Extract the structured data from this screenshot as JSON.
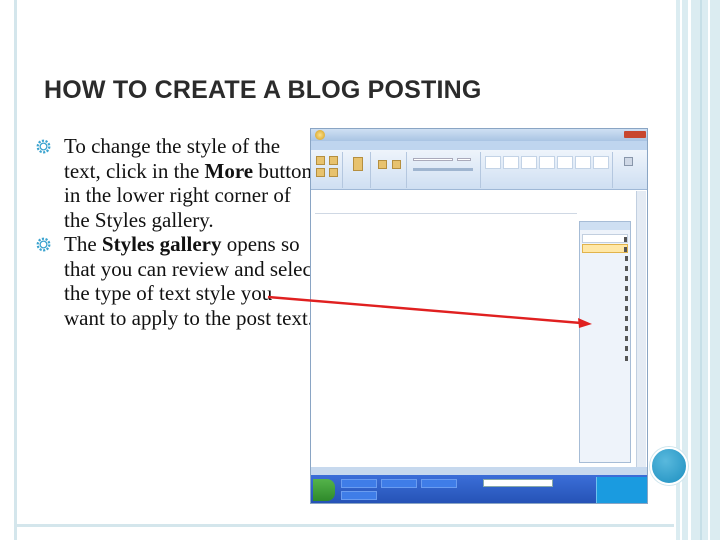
{
  "slide": {
    "title": "HOW TO CREATE A BLOG POSTING",
    "bullets": [
      {
        "before": "To change the style of the text, click in the ",
        "bold": "More",
        "after": " button in the lower right corner of the Styles gallery."
      },
      {
        "before": "The ",
        "bold": "Styles gallery",
        "after": " opens so that you can review and select the type of text style you want to apply to the post text."
      }
    ]
  },
  "colors": {
    "accent_blue": "#1d8fc0",
    "frame": "#d4e6ec",
    "arrow_red": "#e02020"
  },
  "icons": {
    "bullet": "gear-icon"
  }
}
